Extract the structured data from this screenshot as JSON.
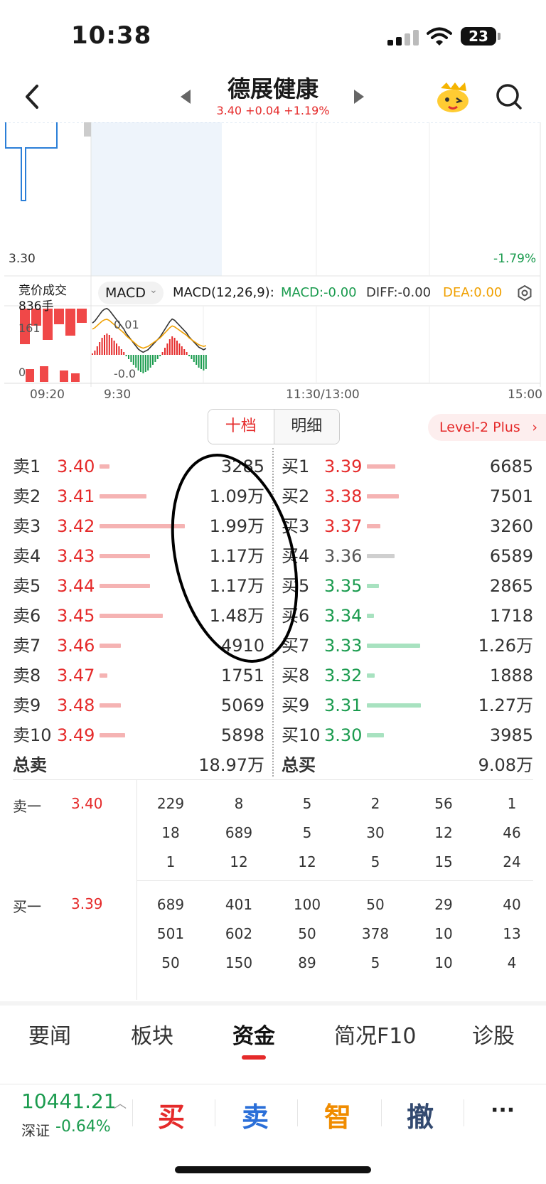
{
  "status_bar": {
    "time": "10:38",
    "battery": "23"
  },
  "header": {
    "stock_name": "德展健康",
    "quote": "3.40 +0.04 +1.19%"
  },
  "chart": {
    "top_price_label": "3.30",
    "top_pct_label": "-1.79%",
    "auction_label": "竞价成交",
    "auction_volume": "836手",
    "indicator_select": "MACD",
    "macd_params": "MACD(12,26,9):",
    "macd_value": "MACD:-0.00",
    "diff_value": "DIFF:-0.00",
    "dea_value": "DEA:0.00",
    "sub_left_top": "161",
    "sub_left_bottom": "0",
    "sub_top": "0.01",
    "sub_bottom": "-0.0",
    "time_axis": [
      "09:20",
      "9:30",
      "11:30/13:00",
      "15:00"
    ],
    "colors": {
      "up": "#e52a2a",
      "down": "#1a9b4e",
      "diff_line": "#333333",
      "dea_line": "#f0a000"
    }
  },
  "tabs": {
    "depth": "十档",
    "detail": "明细",
    "level2": "Level-2 Plus"
  },
  "order_book": {
    "asks": [
      {
        "label": "卖1",
        "price": "3.40",
        "volume": "3285",
        "share": 0.12
      },
      {
        "label": "卖2",
        "price": "3.41",
        "volume": "1.09万",
        "share": 0.55
      },
      {
        "label": "卖3",
        "price": "3.42",
        "volume": "1.99万",
        "share": 1.0
      },
      {
        "label": "卖4",
        "price": "3.43",
        "volume": "1.17万",
        "share": 0.59
      },
      {
        "label": "卖5",
        "price": "3.44",
        "volume": "1.17万",
        "share": 0.59
      },
      {
        "label": "卖6",
        "price": "3.45",
        "volume": "1.48万",
        "share": 0.74
      },
      {
        "label": "卖7",
        "price": "3.46",
        "volume": "4910",
        "share": 0.25
      },
      {
        "label": "卖8",
        "price": "3.47",
        "volume": "1751",
        "share": 0.09
      },
      {
        "label": "卖9",
        "price": "3.48",
        "volume": "5069",
        "share": 0.25
      },
      {
        "label": "卖10",
        "price": "3.49",
        "volume": "5898",
        "share": 0.3
      }
    ],
    "bids": [
      {
        "label": "买1",
        "price": "3.39",
        "volume": "6685",
        "share": 0.5,
        "color": "red"
      },
      {
        "label": "买2",
        "price": "3.38",
        "volume": "7501",
        "share": 0.56,
        "color": "red"
      },
      {
        "label": "买3",
        "price": "3.37",
        "volume": "3260",
        "share": 0.24,
        "color": "red"
      },
      {
        "label": "买4",
        "price": "3.36",
        "volume": "6589",
        "share": 0.49,
        "color": "gray"
      },
      {
        "label": "买5",
        "price": "3.35",
        "volume": "2865",
        "share": 0.21,
        "color": "green"
      },
      {
        "label": "买6",
        "price": "3.34",
        "volume": "1718",
        "share": 0.13,
        "color": "green"
      },
      {
        "label": "买7",
        "price": "3.33",
        "volume": "1.26万",
        "share": 0.94,
        "color": "green"
      },
      {
        "label": "买8",
        "price": "3.32",
        "volume": "1888",
        "share": 0.14,
        "color": "green"
      },
      {
        "label": "买9",
        "price": "3.31",
        "volume": "1.27万",
        "share": 0.95,
        "color": "green"
      },
      {
        "label": "买10",
        "price": "3.30",
        "volume": "3985",
        "share": 0.3,
        "color": "green"
      }
    ],
    "total_ask_label": "总卖",
    "total_ask": "18.97万",
    "total_bid_label": "总买",
    "total_bid": "9.08万"
  },
  "queue": {
    "ask": {
      "label": "卖一",
      "price": "3.40",
      "rows": [
        [
          "229",
          "8",
          "5",
          "2",
          "56",
          "1"
        ],
        [
          "18",
          "689",
          "5",
          "30",
          "12",
          "46"
        ],
        [
          "1",
          "12",
          "12",
          "5",
          "15",
          "24"
        ]
      ]
    },
    "bid": {
      "label": "买一",
      "price": "3.39",
      "rows": [
        [
          "689",
          "401",
          "100",
          "50",
          "29",
          "40"
        ],
        [
          "501",
          "602",
          "50",
          "378",
          "10",
          "13"
        ],
        [
          "50",
          "150",
          "89",
          "5",
          "10",
          "4"
        ]
      ]
    }
  },
  "bottom_tabs": [
    "要闻",
    "板块",
    "资金",
    "简况F10",
    "诊股"
  ],
  "active_bottom_tab": "资金",
  "index": {
    "value": "10441.21",
    "name": "深证",
    "change": "-0.64%"
  },
  "actions": {
    "buy": "买",
    "sell": "卖",
    "smart": "智",
    "cancel": "撤",
    "more": "···"
  }
}
